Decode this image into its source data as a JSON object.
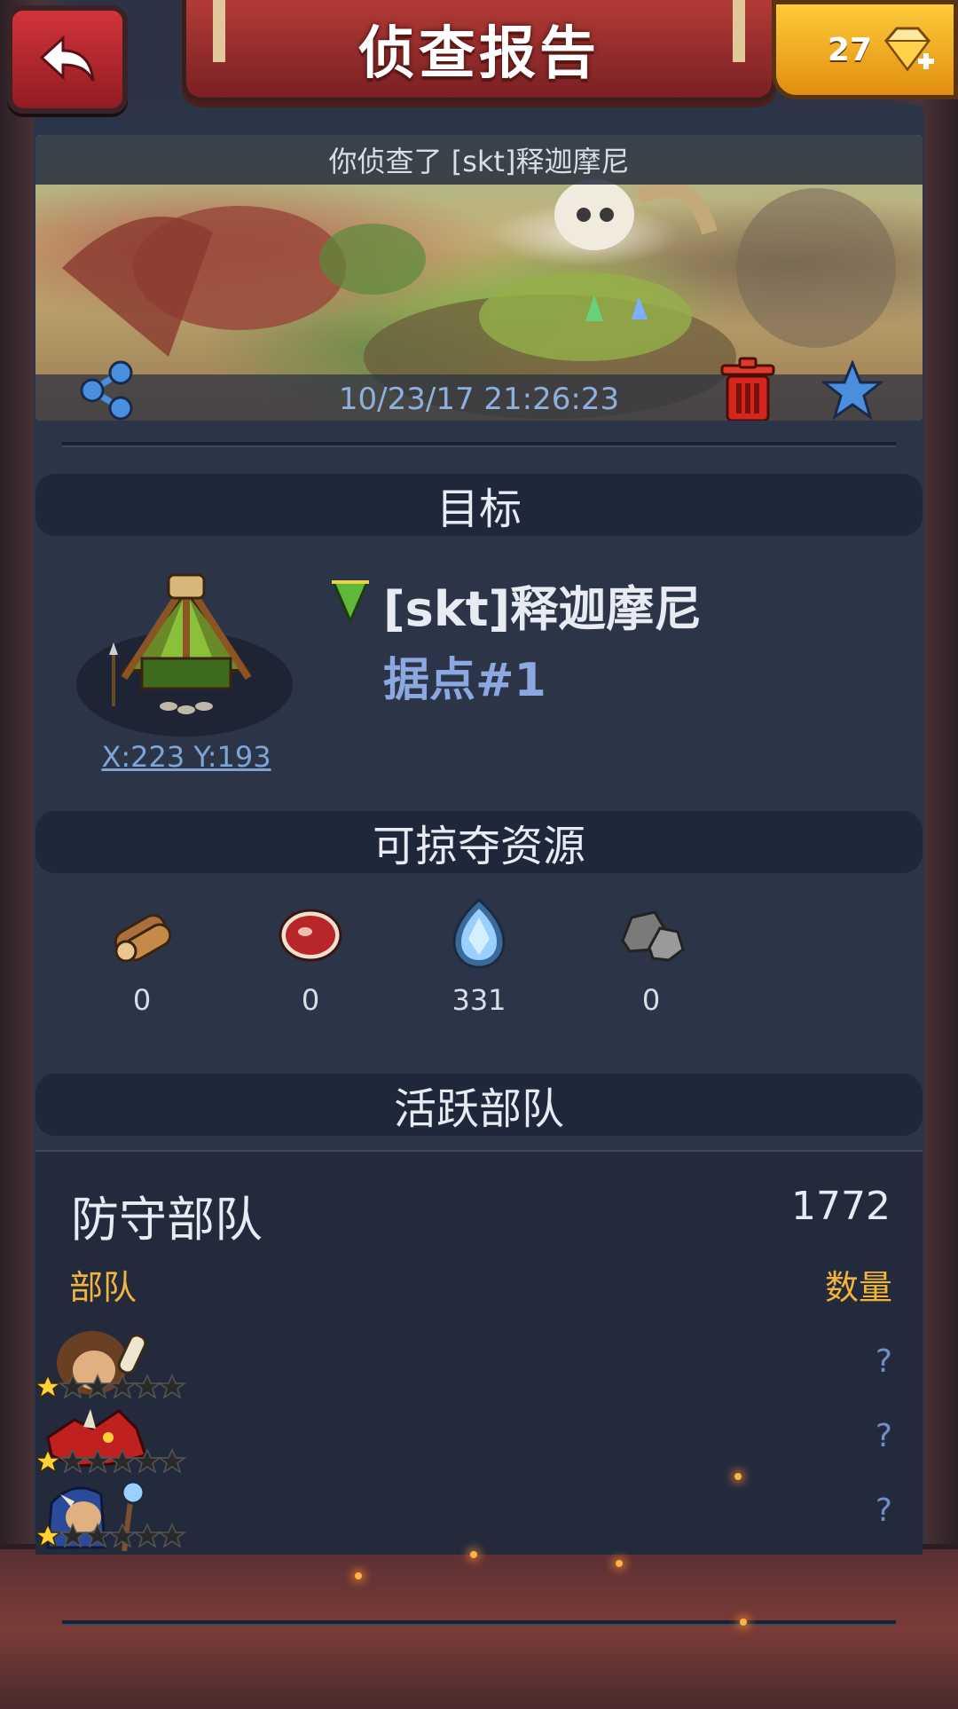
{
  "header": {
    "title": "侦查报告",
    "gems": "27"
  },
  "scout": {
    "caption": "你侦查了 [skt]释迦摩尼",
    "timestamp": "10/23/17 21:26:23"
  },
  "target": {
    "section_title": "目标",
    "player": "[skt]释迦摩尼",
    "stronghold": "据点#1",
    "coords": "X:223 Y:193"
  },
  "resources": {
    "section_title": "可掠夺资源",
    "items": [
      {
        "icon": "wood-icon",
        "value": "0"
      },
      {
        "icon": "meat-icon",
        "value": "0"
      },
      {
        "icon": "crystal-icon",
        "value": "331"
      },
      {
        "icon": "stone-icon",
        "value": "0"
      }
    ]
  },
  "troops": {
    "section_title": "活跃部队",
    "defense_label": "防守部队",
    "defense_total": "1772",
    "col_troop": "部队",
    "col_qty": "数量",
    "rows": [
      {
        "unit": "caveman-club-icon",
        "stars": 1,
        "qty": "?"
      },
      {
        "unit": "red-dragon-icon",
        "stars": 1,
        "qty": "?"
      },
      {
        "unit": "shaman-icon",
        "stars": 1,
        "qty": "?"
      }
    ]
  },
  "colors": {
    "accent_gold": "#f2b43c",
    "link_blue": "#7fa4d6",
    "panel": "#2c3548"
  }
}
